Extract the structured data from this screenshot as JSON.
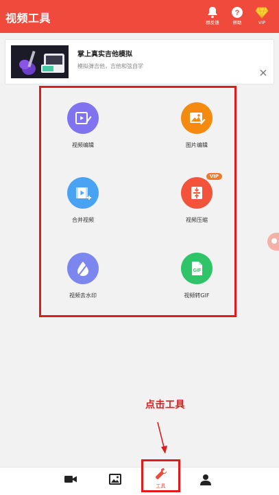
{
  "header": {
    "title": "视频工具",
    "actions": [
      {
        "label": "群反馈",
        "icon": "bell-icon"
      },
      {
        "label": "帮助",
        "icon": "help-icon"
      },
      {
        "label": "VIP",
        "icon": "vip-diamond-icon"
      }
    ]
  },
  "ad": {
    "title": "掌上真实吉他模拟",
    "description": "模拟弹吉他，吉他和弦自学"
  },
  "tools": [
    {
      "label": "视频编辑",
      "icon": "video-edit-icon",
      "color": "#7f73f0"
    },
    {
      "label": "图片编辑",
      "icon": "image-edit-icon",
      "color": "#f58a10"
    },
    {
      "label": "合并视频",
      "icon": "video-merge-icon",
      "color": "#4aa3f2"
    },
    {
      "label": "视频压缩",
      "icon": "video-compress-icon",
      "color": "#f2533a",
      "badge": "VIP"
    },
    {
      "label": "视频去水印",
      "icon": "remove-watermark-icon",
      "color": "#7c86ef"
    },
    {
      "label": "视频转GIF",
      "icon": "video-to-gif-icon",
      "color": "#2fc468"
    }
  ],
  "annotation": "点击工具",
  "bottom_nav": {
    "items": [
      {
        "icon": "video-camera-icon"
      },
      {
        "icon": "image-icon"
      },
      {
        "icon": "wrench-icon",
        "label": "工具",
        "active": true
      },
      {
        "icon": "person-icon"
      }
    ]
  },
  "colors": {
    "primary": "#ef4a3b",
    "highlight": "#e01b1b",
    "background": "#f2f2f2"
  }
}
